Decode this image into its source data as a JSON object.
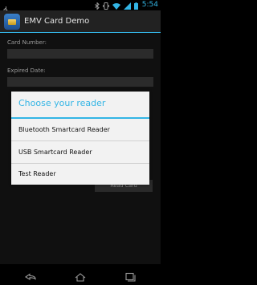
{
  "status_bar": {
    "time": "5:54",
    "icons": [
      "usb-icon",
      "bluetooth-icon",
      "vibrate-icon",
      "wifi-icon",
      "signal-icon",
      "battery-icon"
    ]
  },
  "action_bar": {
    "title": "EMV Card Demo",
    "icon": "emv-card-app-icon"
  },
  "form": {
    "card_number_label": "Card Number:",
    "card_number_value": "",
    "expired_date_label": "Expired Date:",
    "expired_date_value": "",
    "read_card_button": "Read Card"
  },
  "dialog": {
    "title": "Choose your reader",
    "options": [
      {
        "label": "Bluetooth Smartcard Reader"
      },
      {
        "label": "USB Smartcard Reader"
      },
      {
        "label": "Test Reader"
      }
    ]
  },
  "nav_bar": {
    "buttons": [
      "back-icon",
      "home-icon",
      "recent-apps-icon"
    ]
  },
  "colors": {
    "accent": "#33b5e5",
    "background": "#000000",
    "dialog_bg": "#f2f2f2"
  }
}
